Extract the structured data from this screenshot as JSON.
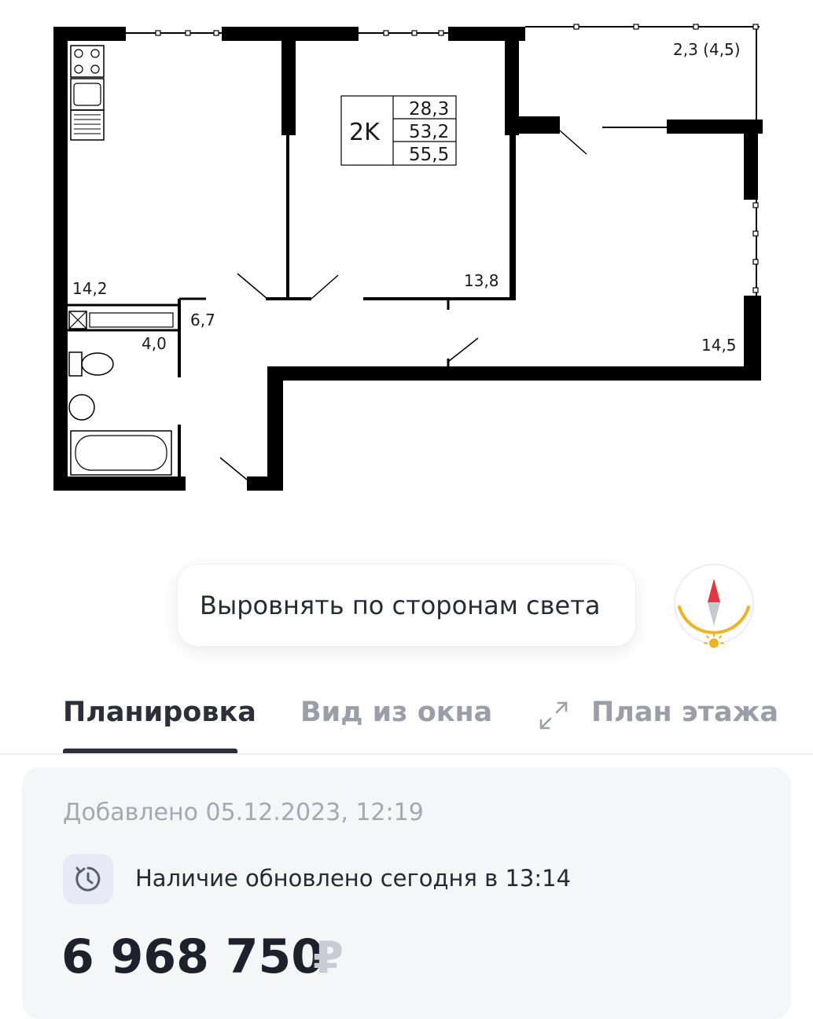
{
  "floorplan": {
    "apartment_code": "2K",
    "areas": [
      "28,3",
      "53,2",
      "55,5"
    ],
    "rooms": {
      "balcony": "2,3 (4,5)",
      "kitchen": "14,2",
      "bedroom": "13,8",
      "living": "14,5",
      "hall": "6,7",
      "bathroom": "4,0"
    }
  },
  "align_button": {
    "label": "Выровнять по сторонам света"
  },
  "compass": {
    "icon": "compass-icon",
    "north_color": "#e8343b",
    "arc_color": "#f2b21a"
  },
  "tabs": [
    {
      "label": "Планировка",
      "active": true
    },
    {
      "label": "Вид из окна",
      "active": false
    },
    {
      "label": "План этажа",
      "active": false
    }
  ],
  "info": {
    "added": "Добавлено 05.12.2023, 12:19",
    "availability": "Наличие обновлено сегодня в 13:14",
    "price": "6 968 750",
    "currency": "₽"
  },
  "colors": {
    "accent": "#2b2f3a",
    "muted": "#9a9ea8",
    "card_bg": "#f5f6f8"
  }
}
